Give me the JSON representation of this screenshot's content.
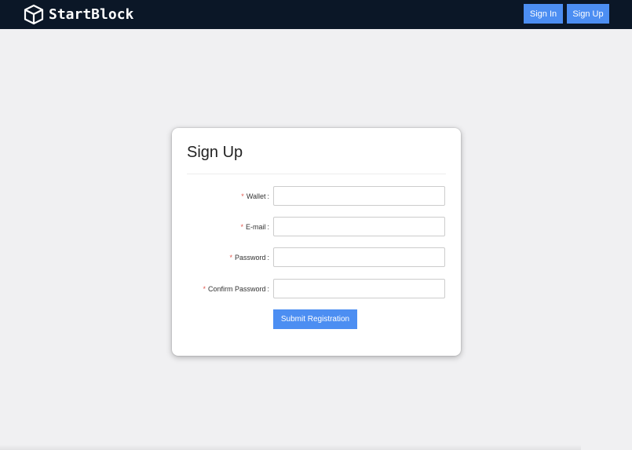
{
  "header": {
    "brand_name": "StartBlock",
    "logo_icon": "cube-icon",
    "signin_label": "Sign In",
    "signup_label": "Sign Up"
  },
  "form": {
    "title": "Sign Up",
    "required_marker": "*",
    "fields": [
      {
        "label": "Wallet",
        "value": "",
        "type": "text"
      },
      {
        "label": "E-mail",
        "value": "",
        "type": "email"
      },
      {
        "label": "Password",
        "value": "",
        "type": "password"
      },
      {
        "label": "Confirm Password",
        "value": "",
        "type": "password"
      }
    ],
    "submit_label": "Submit Registration"
  },
  "colors": {
    "header_bg": "#0b1727",
    "accent": "#4c8ef2",
    "page_bg": "#f0f0f2",
    "required": "#e0584f"
  }
}
